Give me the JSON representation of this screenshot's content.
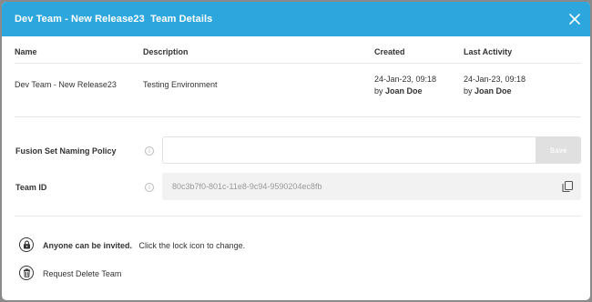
{
  "dialog": {
    "title": "Dev Team - New Release23  Team Details",
    "close_icon": "close-icon"
  },
  "table": {
    "headers": [
      "Name",
      "Description",
      "Created",
      "Last Activity"
    ],
    "row": {
      "name": "Dev Team - New Release23",
      "description": "Testing Environment",
      "created_date": "24-Jan-23, 09:18",
      "created_by_prefix": "by",
      "created_by": "Joan Doe",
      "last_activity_date": "24-Jan-23, 09:18",
      "last_activity_by_prefix": "by",
      "last_activity_by": "Joan Doe"
    }
  },
  "naming_policy": {
    "label": "Fusion Set Naming Policy",
    "value": "",
    "save_label": "Save"
  },
  "team_id": {
    "label": "Team ID",
    "value": "80c3b7f0-801c-11e8-9c94-9590204ec8fb",
    "copy_icon": "copy-icon"
  },
  "footer": {
    "invite_bold": "Anyone can be invited.",
    "invite_hint": "Click the lock icon to change.",
    "delete_label": "Request Delete Team"
  }
}
